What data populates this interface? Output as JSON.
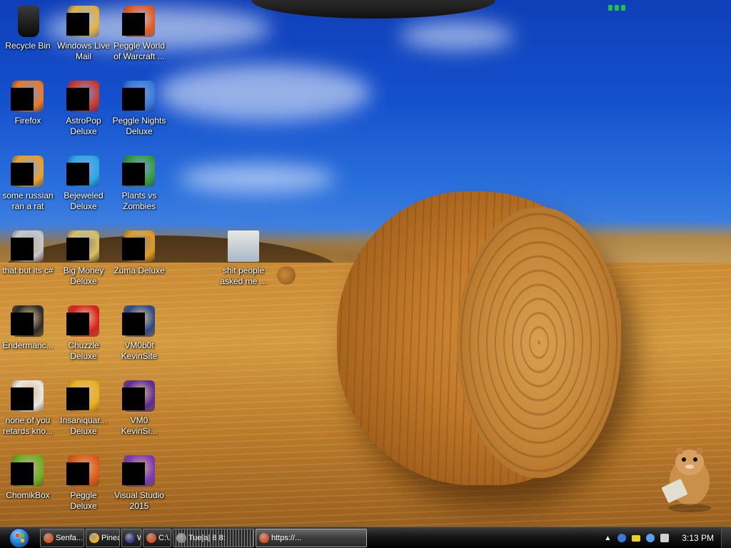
{
  "desktop": {
    "icons": [
      {
        "label": "Recycle Bin",
        "icon": "recycle-bin-icon",
        "color": "#1b1b1b",
        "redacted": false
      },
      {
        "label": "Windows Live\nMail",
        "icon": "windows-live-mail-icon",
        "color": "#e3b23c",
        "redacted": true
      },
      {
        "label": "Peggle World\nof Warcraft ...",
        "icon": "peggle-world-of-warcraft-icon",
        "color": "#e85a1a",
        "redacted": true
      },
      {
        "label": "Firefox",
        "icon": "firefox-icon",
        "color": "#f07a1a",
        "redacted": true
      },
      {
        "label": "AstroPop\nDeluxe",
        "icon": "astropop-deluxe-icon",
        "color": "#d23a2a",
        "redacted": true
      },
      {
        "label": "Peggle Nights\nDeluxe",
        "icon": "peggle-nights-deluxe-icon",
        "color": "#3a7ad8",
        "redacted": true
      },
      {
        "label": "some russian\nran a rat",
        "icon": "some-russian-ran-a-rat-icon",
        "color": "#f0a020",
        "redacted": true
      },
      {
        "label": "Bejeweled\nDeluxe",
        "icon": "bejeweled-deluxe-icon",
        "color": "#2aa8e0",
        "redacted": true
      },
      {
        "label": "Plants vs\nZombies",
        "icon": "plants-vs-zombies-icon",
        "color": "#3a9a3a",
        "redacted": true
      },
      {
        "label": "that but its c#",
        "icon": "that-but-its-csharp-icon",
        "color": "#c8c8c8",
        "redacted": true
      },
      {
        "label": "Big Money\nDeluxe",
        "icon": "big-money-deluxe-icon",
        "color": "#d8c060",
        "redacted": true
      },
      {
        "label": "Zuma Deluxe",
        "icon": "zuma-deluxe-icon",
        "color": "#e09a20",
        "redacted": true
      },
      {
        "label": "Endermanc...",
        "icon": "endermanch-icon",
        "color": "#2a2a2a",
        "redacted": true
      },
      {
        "label": "Chuzzle\nDeluxe",
        "icon": "chuzzle-deluxe-icon",
        "color": "#d82020",
        "redacted": true
      },
      {
        "label": "VM0b0t\nKevinSite",
        "icon": "vm0b0t-kevinsite-icon",
        "color": "#2a4a8a",
        "redacted": true
      },
      {
        "label": "none of you\nretards kno...",
        "icon": "none-of-you-icon",
        "color": "#e8e8e8",
        "redacted": true
      },
      {
        "label": "Insaniquar...\nDeluxe",
        "icon": "insaniquarium-deluxe-icon",
        "color": "#e8b020",
        "redacted": true
      },
      {
        "label": "VM0\nKevinSi...",
        "icon": "vm0-kevinsite-icon",
        "color": "#5a2a9a",
        "redacted": true
      },
      {
        "label": "ChomikBox",
        "icon": "chomikbox-icon",
        "color": "#6ab02a",
        "redacted": true
      },
      {
        "label": "Peggle Deluxe",
        "icon": "peggle-deluxe-icon",
        "color": "#e05a1a",
        "redacted": true
      },
      {
        "label": "Visual Studio\n2015",
        "icon": "visual-studio-2015-icon",
        "color": "#7a3ab8",
        "redacted": true
      },
      {
        "label": "shit people\nasked me ...",
        "icon": "folder-icon",
        "color": "#8ab0d8",
        "redacted": false
      }
    ]
  },
  "taskbar": {
    "start_icon": "windows-start-orb-icon",
    "buttons": [
      {
        "label": "Senfa...",
        "icon": "firefox-icon",
        "color": "#e0501a",
        "style": "normal"
      },
      {
        "label": "Pinea...",
        "icon": "play-icon",
        "color": "#f0b020",
        "style": "normal"
      },
      {
        "label": "Wi...",
        "icon": "app-icon",
        "color": "#3a3a8a",
        "style": "normal"
      },
      {
        "label": "C:\\...",
        "icon": "firefox-icon",
        "color": "#e0501a",
        "style": "normal"
      },
      {
        "label": "Tue|a| 8 8:",
        "icon": "window-icon",
        "color": "#888888",
        "style": "stripes"
      },
      {
        "label": "https://...",
        "icon": "firefox-icon",
        "color": "#e0501a",
        "style": "active"
      }
    ],
    "tray": {
      "show_hidden_label": "▲",
      "icons": [
        "hard-drive-icon",
        "battery-icon",
        "speaker-icon",
        "network-icon"
      ],
      "clock": "3:13 PM"
    }
  }
}
